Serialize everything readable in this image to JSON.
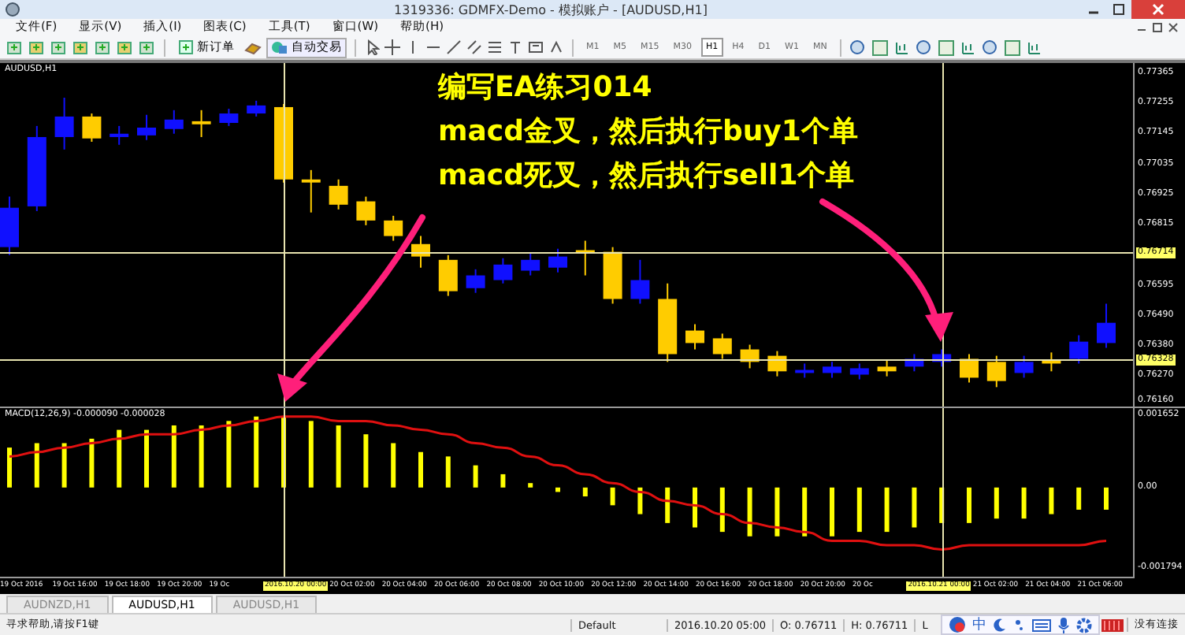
{
  "window": {
    "title": "1319336: GDMFX-Demo - 模拟账户 - [AUDUSD,H1]"
  },
  "menu": [
    "文件(F)",
    "显示(V)",
    "插入(I)",
    "图表(C)",
    "工具(T)",
    "窗口(W)",
    "帮助(H)"
  ],
  "toolbar": {
    "new_order": "新订单",
    "auto_trading": "自动交易",
    "timeframes": [
      {
        "label": "M1",
        "selected": false
      },
      {
        "label": "M5",
        "selected": false
      },
      {
        "label": "M15",
        "selected": false
      },
      {
        "label": "M30",
        "selected": false
      },
      {
        "label": "H1",
        "selected": true
      },
      {
        "label": "H4",
        "selected": false
      },
      {
        "label": "D1",
        "selected": false
      },
      {
        "label": "W1",
        "selected": false
      },
      {
        "label": "MN",
        "selected": false
      }
    ]
  },
  "chart": {
    "symbol": "AUDUSD,H1",
    "chart_data": {
      "type": "candlestick",
      "ylim": [
        0.76159,
        0.77398
      ],
      "ref_lines": [
        {
          "axis": "y",
          "value": 0.76714,
          "label": "0.76714"
        },
        {
          "axis": "y",
          "value": 0.76328,
          "label": "0.76328"
        }
      ],
      "yticks": [
        {
          "value": 0.77365,
          "label": "0.77365"
        },
        {
          "value": 0.77255,
          "label": "0.77255"
        },
        {
          "value": 0.77145,
          "label": "0.77145"
        },
        {
          "value": 0.77035,
          "label": "0.77035"
        },
        {
          "value": 0.76925,
          "label": "0.76925"
        },
        {
          "value": 0.76815,
          "label": "0.76815"
        },
        {
          "value": 0.76595,
          "label": "0.76595"
        },
        {
          "value": 0.7649,
          "label": "0.76490"
        },
        {
          "value": 0.7638,
          "label": "0.76380"
        },
        {
          "value": 0.7627,
          "label": "0.76270"
        },
        {
          "value": 0.7616,
          "label": "0.76160"
        }
      ],
      "ohlc": [
        [
          0.76734,
          0.76916,
          0.76705,
          0.76876
        ],
        [
          0.76881,
          0.77171,
          0.76864,
          0.77131
        ],
        [
          0.77131,
          0.77273,
          0.77086,
          0.77205
        ],
        [
          0.77205,
          0.77216,
          0.77114,
          0.77126
        ],
        [
          0.77131,
          0.77171,
          0.77103,
          0.77143
        ],
        [
          0.77137,
          0.77211,
          0.7712,
          0.77165
        ],
        [
          0.7716,
          0.77228,
          0.77143,
          0.77194
        ],
        [
          0.77188,
          0.77228,
          0.77131,
          0.77177
        ],
        [
          0.77182,
          0.77233,
          0.77171,
          0.77216
        ],
        [
          0.77216,
          0.77262,
          0.77205,
          0.77245
        ],
        [
          0.77239,
          0.7725,
          0.76967,
          0.76978
        ],
        [
          0.76978,
          0.77012,
          0.76859,
          0.76967
        ],
        [
          0.76955,
          0.76978,
          0.7687,
          0.76887
        ],
        [
          0.76899,
          0.76916,
          0.76813,
          0.7683
        ],
        [
          0.7683,
          0.76847,
          0.76757,
          0.76774
        ],
        [
          0.76745,
          0.76774,
          0.7666,
          0.767
        ],
        [
          0.76688,
          0.76705,
          0.76558,
          0.76575
        ],
        [
          0.76586,
          0.76654,
          0.76569,
          0.76632
        ],
        [
          0.76615,
          0.76694,
          0.76603,
          0.76671
        ],
        [
          0.76649,
          0.76711,
          0.76632,
          0.76688
        ],
        [
          0.7666,
          0.76728,
          0.76643,
          0.767
        ],
        [
          0.76723,
          0.76757,
          0.76632,
          0.76711
        ],
        [
          0.76717,
          0.76734,
          0.7653,
          0.76547
        ],
        [
          0.76547,
          0.76688,
          0.7653,
          0.76615
        ],
        [
          0.76547,
          0.76603,
          0.7632,
          0.76348
        ],
        [
          0.76433,
          0.76456,
          0.76365,
          0.76388
        ],
        [
          0.76405,
          0.76422,
          0.76331,
          0.76348
        ],
        [
          0.76365,
          0.76382,
          0.76297,
          0.7632
        ],
        [
          0.76342,
          0.76359,
          0.76268,
          0.76286
        ],
        [
          0.7628,
          0.76314,
          0.76263,
          0.76291
        ],
        [
          0.7628,
          0.7632,
          0.76263,
          0.76303
        ],
        [
          0.76274,
          0.76314,
          0.76257,
          0.76297
        ],
        [
          0.76303,
          0.76325,
          0.76268,
          0.76286
        ],
        [
          0.76303,
          0.76348,
          0.76286,
          0.76331
        ],
        [
          0.7632,
          0.76365,
          0.76303,
          0.76348
        ],
        [
          0.76331,
          0.76348,
          0.76246,
          0.76263
        ],
        [
          0.7632,
          0.76342,
          0.76229,
          0.76251
        ],
        [
          0.7628,
          0.76342,
          0.76263,
          0.7632
        ],
        [
          0.76325,
          0.76354,
          0.76286,
          0.76314
        ],
        [
          0.76331,
          0.76416,
          0.76314,
          0.76393
        ],
        [
          0.76388,
          0.7653,
          0.76371,
          0.76461
        ]
      ]
    },
    "indicator": {
      "label": "MACD(12,26,9) -0.000090 -0.000028",
      "chart_data": {
        "type": "bar",
        "ylim": [
          -0.00201,
          0.00179
        ],
        "yticks": [
          {
            "value": 0.001652,
            "label": "0.001652"
          },
          {
            "value": 0,
            "label": "0.00"
          },
          {
            "value": -0.001794,
            "label": "-0.001794"
          }
        ],
        "series": [
          {
            "color": "#ffff00",
            "values": [
              0.0009,
              0.001,
              0.001,
              0.0011,
              0.0013,
              0.0013,
              0.0014,
              0.0014,
              0.0015,
              0.0016,
              0.0016,
              0.0015,
              0.0014,
              0.0012,
              0.001,
              0.0008,
              0.0007,
              0.0005,
              0.0003,
              0.0001,
              -0.0001,
              -0.0002,
              -0.0004,
              -0.0006,
              -0.0008,
              -0.0009,
              -0.001,
              -0.0011,
              -0.0011,
              -0.0011,
              -0.0011,
              -0.001,
              -0.001,
              -0.0009,
              -0.0008,
              -0.0008,
              -0.0007,
              -0.0007,
              -0.0006,
              -0.0005,
              -0.0005
            ]
          },
          {
            "type": "line",
            "color": "#e01010",
            "values": [
              0.0007,
              0.0008,
              0.0009,
              0.001,
              0.0011,
              0.0012,
              0.0012,
              0.0013,
              0.0014,
              0.0015,
              0.0016,
              0.0016,
              0.0015,
              0.0015,
              0.0014,
              0.0013,
              0.0012,
              0.001,
              0.0009,
              0.0007,
              0.0005,
              0.0003,
              0.0001,
              -0.0001,
              -0.0003,
              -0.0004,
              -0.0006,
              -0.0008,
              -0.0009,
              -0.001,
              -0.0012,
              -0.0012,
              -0.0013,
              -0.0013,
              -0.0014,
              -0.0013,
              -0.0013,
              -0.0013,
              -0.0013,
              -0.0013,
              -0.0012
            ]
          }
        ]
      }
    },
    "time_axis": [
      {
        "label": "19 Oct 2016",
        "kind": "tick"
      },
      {
        "label": "19 Oct 16:00",
        "kind": "tick"
      },
      {
        "label": "19 Oct 18:00",
        "kind": "tick"
      },
      {
        "label": "19 Oct 20:00",
        "kind": "tick"
      },
      {
        "label": "19 Oc",
        "kind": "tick"
      },
      {
        "label": "2016.10.20 00:00",
        "kind": "cursor"
      },
      {
        "label": "20 Oct 02:00",
        "kind": "tick"
      },
      {
        "label": "20 Oct 04:00",
        "kind": "tick"
      },
      {
        "label": "20 Oct 06:00",
        "kind": "tick"
      },
      {
        "label": "20 Oct 08:00",
        "kind": "tick"
      },
      {
        "label": "20 Oct 10:00",
        "kind": "tick"
      },
      {
        "label": "20 Oct 12:00",
        "kind": "tick"
      },
      {
        "label": "20 Oct 14:00",
        "kind": "tick"
      },
      {
        "label": "20 Oct 16:00",
        "kind": "tick"
      },
      {
        "label": "20 Oct 18:00",
        "kind": "tick"
      },
      {
        "label": "20 Oct 20:00",
        "kind": "tick"
      },
      {
        "label": "20 Oc",
        "kind": "tick"
      },
      {
        "label": "2016.10.21 00:00",
        "kind": "cursor"
      },
      {
        "label": "21 Oct 02:00",
        "kind": "tick"
      },
      {
        "label": "21 Oct 04:00",
        "kind": "tick"
      },
      {
        "label": "21 Oct 06:00",
        "kind": "tick"
      }
    ],
    "annotation": {
      "title": "编写EA练习014",
      "lines": [
        "macd金叉，然后执行buy1个单",
        "macd死叉，然后执行sell1个单"
      ]
    }
  },
  "tabs": [
    {
      "label": "AUDNZD,H1",
      "selected": false
    },
    {
      "label": "AUDUSD,H1",
      "selected": true
    },
    {
      "label": "AUDUSD,H1",
      "selected": false
    }
  ],
  "status_bar": {
    "help": "寻求帮助,请按F1键",
    "profile": "Default",
    "time": "2016.10.20 05:00",
    "open": "O: 0.76711",
    "high": "H: 0.76711",
    "low": "L",
    "ime": "中",
    "connection": "没有连接"
  }
}
